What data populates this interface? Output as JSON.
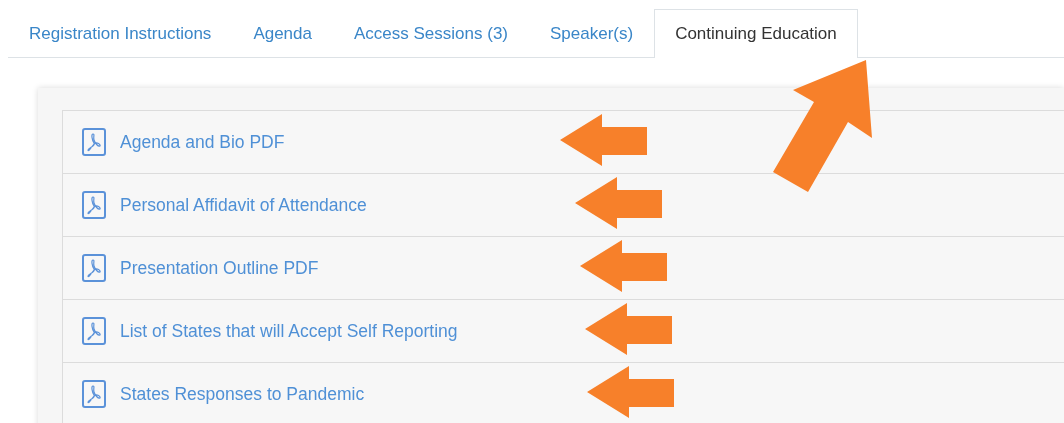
{
  "tabs": [
    {
      "label": "Registration Instructions",
      "selected": false
    },
    {
      "label": "Agenda",
      "selected": false
    },
    {
      "label": "Access Sessions (3)",
      "selected": false
    },
    {
      "label": "Speaker(s)",
      "selected": false
    },
    {
      "label": "Continuing Education",
      "selected": true
    }
  ],
  "documents": [
    {
      "label": "Agenda and Bio PDF"
    },
    {
      "label": "Personal Affidavit of Attendance"
    },
    {
      "label": "Presentation Outline PDF"
    },
    {
      "label": "List of States that will Accept Self Reporting"
    },
    {
      "label": "States Responses to Pandemic"
    }
  ]
}
